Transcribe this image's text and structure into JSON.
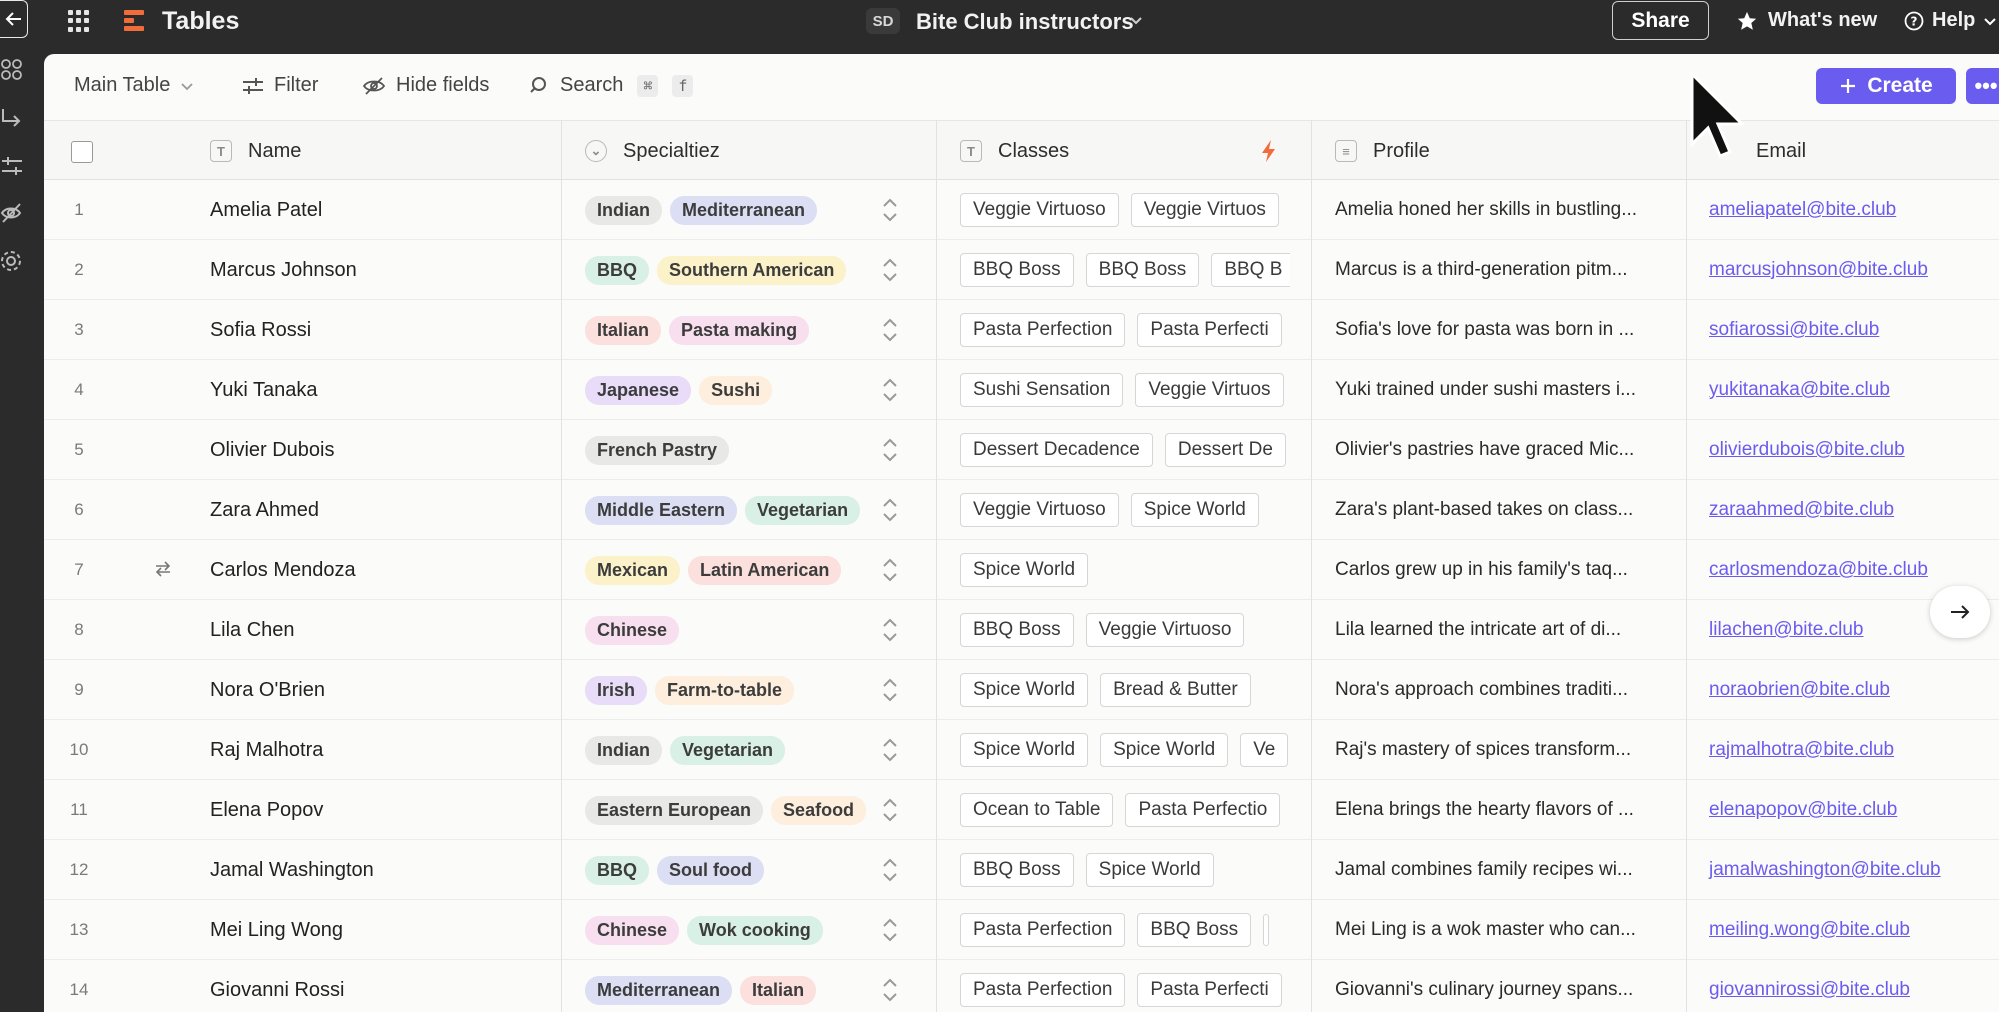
{
  "app": {
    "title": "Tables"
  },
  "table": {
    "initials": "SD",
    "name": "Bite Club instructors"
  },
  "topbar": {
    "share_label": "Share",
    "whats_new_label": "What's new",
    "help_label": "Help"
  },
  "toolbar": {
    "view_label": "Main Table",
    "filter_label": "Filter",
    "hide_fields_label": "Hide fields",
    "search_label": "Search",
    "search_shortcut_mod": "⌘",
    "search_shortcut_key": "f",
    "create_label": "Create",
    "more_label": "•••"
  },
  "columns": {
    "name": "Name",
    "specialties": "Specialtiez",
    "classes": "Classes",
    "profile": "Profile",
    "email": "Email"
  },
  "tag_colors": {
    "gray": "#e8e8e6",
    "blue": "#dcdff4",
    "green": "#d8f0e6",
    "yellow": "#fbf2c9",
    "red": "#fbe0dd",
    "pink": "#f8dfef",
    "purple": "#e8dcf8",
    "peach": "#fdeedd"
  },
  "accent_color": "#6b5cf0",
  "rows": [
    {
      "num": "1",
      "name": "Amelia Patel",
      "tags": [
        [
          "Indian",
          "gray"
        ],
        [
          "Mediterranean",
          "blue"
        ]
      ],
      "classes": [
        "Veggie Virtuoso",
        "Veggie Virtuos"
      ],
      "profile": "Amelia honed her skills in bustling...",
      "email": "ameliapatel@bite.club"
    },
    {
      "num": "2",
      "name": "Marcus Johnson",
      "tags": [
        [
          "BBQ",
          "green"
        ],
        [
          "Southern American",
          "yellow"
        ]
      ],
      "classes": [
        "BBQ Boss",
        "BBQ Boss",
        "BBQ B"
      ],
      "profile": "Marcus is a third-generation pitm...",
      "email": "marcusjohnson@bite.club"
    },
    {
      "num": "3",
      "name": "Sofia Rossi",
      "tags": [
        [
          "Italian",
          "red"
        ],
        [
          "Pasta making",
          "pink"
        ]
      ],
      "classes": [
        "Pasta Perfection",
        "Pasta Perfecti"
      ],
      "profile": "Sofia's love for pasta was born in ...",
      "email": "sofiarossi@bite.club"
    },
    {
      "num": "4",
      "name": "Yuki Tanaka",
      "tags": [
        [
          "Japanese",
          "purple"
        ],
        [
          "Sushi",
          "peach"
        ]
      ],
      "classes": [
        "Sushi Sensation",
        "Veggie Virtuos"
      ],
      "profile": "Yuki trained under sushi masters i...",
      "email": "yukitanaka@bite.club"
    },
    {
      "num": "5",
      "name": "Olivier Dubois",
      "tags": [
        [
          "French Pastry",
          "gray"
        ]
      ],
      "classes": [
        "Dessert Decadence",
        "Dessert De"
      ],
      "profile": "Olivier's pastries have graced Mic...",
      "email": "olivierdubois@bite.club"
    },
    {
      "num": "6",
      "name": "Zara Ahmed",
      "tags": [
        [
          "Middle Eastern",
          "blue"
        ],
        [
          "Vegetarian",
          "green"
        ]
      ],
      "classes": [
        "Veggie Virtuoso",
        "Spice World"
      ],
      "profile": "Zara's plant-based takes on class...",
      "email": "zaraahmed@bite.club"
    },
    {
      "num": "7",
      "name": "Carlos Mendoza",
      "tags": [
        [
          "Mexican",
          "yellow"
        ],
        [
          "Latin American",
          "red"
        ]
      ],
      "classes": [
        "Spice World"
      ],
      "profile": "Carlos grew up in his family's taq...",
      "email": "carlosmendoza@bite.club"
    },
    {
      "num": "8",
      "name": "Lila Chen",
      "tags": [
        [
          "Chinese",
          "pink"
        ]
      ],
      "classes": [
        "BBQ Boss",
        "Veggie Virtuoso"
      ],
      "profile": "Lila learned the intricate art of di...",
      "email": "lilachen@bite.club"
    },
    {
      "num": "9",
      "name": "Nora O'Brien",
      "tags": [
        [
          "Irish",
          "purple"
        ],
        [
          "Farm-to-table",
          "peach"
        ]
      ],
      "classes": [
        "Spice World",
        "Bread & Butter"
      ],
      "profile": "Nora's approach combines traditi...",
      "email": "noraobrien@bite.club"
    },
    {
      "num": "10",
      "name": "Raj Malhotra",
      "tags": [
        [
          "Indian",
          "gray"
        ],
        [
          "Vegetarian",
          "green"
        ]
      ],
      "classes": [
        "Spice World",
        "Spice World",
        "Ve"
      ],
      "profile": "Raj's mastery of spices transform...",
      "email": "rajmalhotra@bite.club"
    },
    {
      "num": "11",
      "name": "Elena Popov",
      "tags": [
        [
          "Eastern European",
          "gray"
        ],
        [
          "Seafood",
          "peach"
        ]
      ],
      "classes": [
        "Ocean to Table",
        "Pasta Perfectio"
      ],
      "profile": "Elena brings the hearty flavors of ...",
      "email": "elenapopov@bite.club"
    },
    {
      "num": "12",
      "name": "Jamal Washington",
      "tags": [
        [
          "BBQ",
          "green"
        ],
        [
          "Soul food",
          "blue"
        ]
      ],
      "classes": [
        "BBQ Boss",
        "Spice World"
      ],
      "profile": "Jamal combines family recipes wi...",
      "email": "jamalwashington@bite.club"
    },
    {
      "num": "13",
      "name": "Mei Ling Wong",
      "tags": [
        [
          "Chinese",
          "pink"
        ],
        [
          "Wok cooking",
          "green"
        ]
      ],
      "classes": [
        "Pasta Perfection",
        "BBQ Boss",
        ""
      ],
      "profile": "Mei Ling is a wok master who can...",
      "email": "meiling.wong@bite.club"
    },
    {
      "num": "14",
      "name": "Giovanni Rossi",
      "tags": [
        [
          "Mediterranean",
          "blue"
        ],
        [
          "Italian",
          "red"
        ]
      ],
      "classes": [
        "Pasta Perfection",
        "Pasta Perfecti"
      ],
      "profile": "Giovanni's culinary journey spans...",
      "email": "giovannirossi@bite.club"
    }
  ]
}
